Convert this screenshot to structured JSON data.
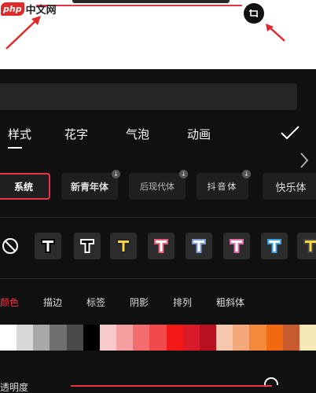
{
  "watermark": {
    "badge": "php",
    "text": "中文网"
  },
  "tabs": [
    {
      "label": "样式"
    },
    {
      "label": "花字"
    },
    {
      "label": "气泡"
    },
    {
      "label": "动画"
    }
  ],
  "fonts": [
    {
      "label": "系统"
    },
    {
      "label": "新青年体"
    },
    {
      "label": "后现代体"
    },
    {
      "label": "抖音体"
    },
    {
      "label": "快乐体"
    }
  ],
  "text_styles": [
    {
      "fill": "#ffffff",
      "stroke": "#000000"
    },
    {
      "fill": "#000000",
      "stroke": "#ffffff"
    },
    {
      "fill": "#f5d546",
      "stroke": "#222222"
    },
    {
      "fill": "#ffffff",
      "stroke": "#e86070"
    },
    {
      "fill": "#ffffff",
      "stroke": "#7a9ad8"
    },
    {
      "fill": "#ffffff",
      "stroke": "#e06aa8"
    },
    {
      "fill": "#ffffff",
      "stroke": "#3aa0e8"
    },
    {
      "fill": "#f5d546",
      "stroke": "#444444"
    }
  ],
  "sub_tabs": [
    {
      "label": "颜色",
      "active": true
    },
    {
      "label": "描边"
    },
    {
      "label": "标签"
    },
    {
      "label": "阴影"
    },
    {
      "label": "排列"
    },
    {
      "label": "粗斜体"
    }
  ],
  "swatches": [
    "#ffffff",
    "#d8d8d8",
    "#a8a8a8",
    "#707070",
    "#4a4a4a",
    "#000000",
    "#f7c9c9",
    "#f4a0a0",
    "#f26d6d",
    "#f24a4a",
    "#f21818",
    "#d91a28",
    "#b8101e",
    "#f7c8b0",
    "#f5a97a",
    "#f5893a",
    "#f26a10",
    "#c85a30",
    "#f7e8b8"
  ],
  "opacity": {
    "label": "透明度",
    "value": 0.97
  },
  "colors": {
    "accent": "#e8344a",
    "panel": "#101010"
  }
}
